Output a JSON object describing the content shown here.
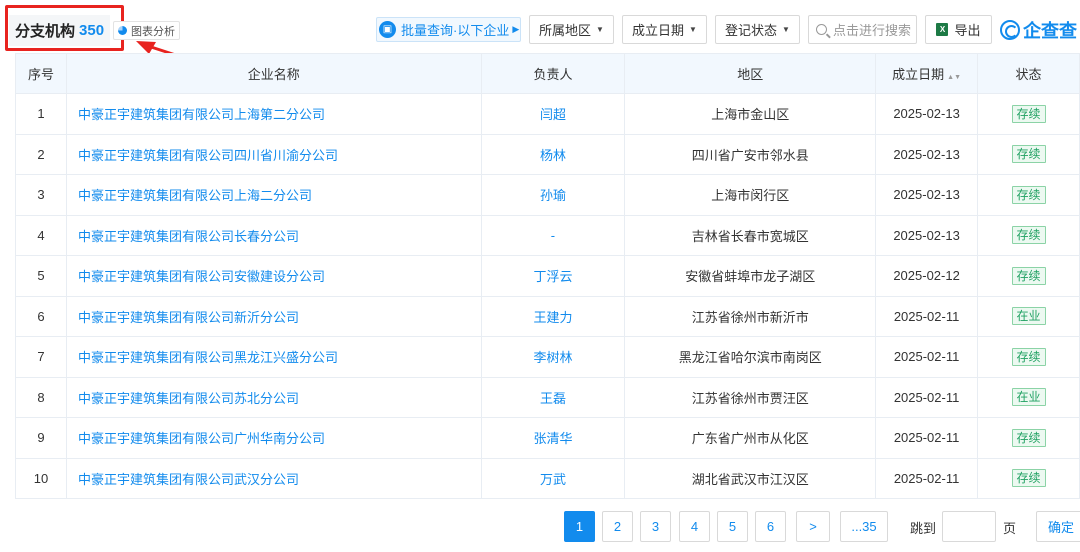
{
  "section": {
    "title": "分支机构",
    "count": "350",
    "chart_analysis": "图表分析"
  },
  "toolbar": {
    "batch_query": "批量查询·以下企业",
    "region": "所属地区",
    "founded": "成立日期",
    "reg_status": "登记状态",
    "search_placeholder": "点击进行搜索",
    "export": "导出",
    "export_icon_text": "X",
    "brand": "企查查"
  },
  "table": {
    "headers": {
      "index": "序号",
      "name": "企业名称",
      "manager": "负责人",
      "region": "地区",
      "date": "成立日期",
      "sort_icon": "▲▼",
      "status": "状态"
    },
    "rows": [
      {
        "index": "1",
        "name": "中豪正宇建筑集团有限公司上海第二分公司",
        "manager": "闫超",
        "region": "上海市金山区",
        "date": "2025-02-13",
        "status": "存续"
      },
      {
        "index": "2",
        "name": "中豪正宇建筑集团有限公司四川省川渝分公司",
        "manager": "杨林",
        "region": "四川省广安市邻水县",
        "date": "2025-02-13",
        "status": "存续"
      },
      {
        "index": "3",
        "name": "中豪正宇建筑集团有限公司上海二分公司",
        "manager": "孙瑜",
        "region": "上海市闵行区",
        "date": "2025-02-13",
        "status": "存续"
      },
      {
        "index": "4",
        "name": "中豪正宇建筑集团有限公司长春分公司",
        "manager": "-",
        "region": "吉林省长春市宽城区",
        "date": "2025-02-13",
        "status": "存续"
      },
      {
        "index": "5",
        "name": "中豪正宇建筑集团有限公司安徽建设分公司",
        "manager": "丁浮云",
        "region": "安徽省蚌埠市龙子湖区",
        "date": "2025-02-12",
        "status": "存续"
      },
      {
        "index": "6",
        "name": "中豪正宇建筑集团有限公司新沂分公司",
        "manager": "王建力",
        "region": "江苏省徐州市新沂市",
        "date": "2025-02-11",
        "status": "在业"
      },
      {
        "index": "7",
        "name": "中豪正宇建筑集团有限公司黑龙江兴盛分公司",
        "manager": "李树林",
        "region": "黑龙江省哈尔滨市南岗区",
        "date": "2025-02-11",
        "status": "存续"
      },
      {
        "index": "8",
        "name": "中豪正宇建筑集团有限公司苏北分公司",
        "manager": "王磊",
        "region": "江苏省徐州市贾汪区",
        "date": "2025-02-11",
        "status": "在业"
      },
      {
        "index": "9",
        "name": "中豪正宇建筑集团有限公司广州华南分公司",
        "manager": "张清华",
        "region": "广东省广州市从化区",
        "date": "2025-02-11",
        "status": "存续"
      },
      {
        "index": "10",
        "name": "中豪正宇建筑集团有限公司武汉分公司",
        "manager": "万武",
        "region": "湖北省武汉市江汉区",
        "date": "2025-02-11",
        "status": "存续"
      }
    ]
  },
  "pagination": {
    "pages": [
      "1",
      "2",
      "3",
      "4",
      "5",
      "6"
    ],
    "next": ">",
    "last": "...35",
    "current": "1",
    "jump_label": "跳到",
    "page_suffix": "页",
    "confirm": "确定"
  },
  "colors": {
    "accent": "#128bed",
    "highlight": "#e8231f",
    "status_green": "#20a162"
  }
}
